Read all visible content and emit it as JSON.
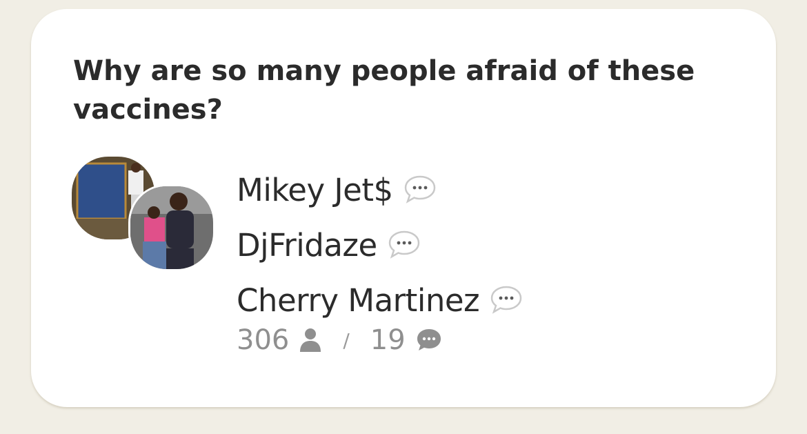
{
  "room": {
    "title": "Why are so many people afraid of these vaccines?",
    "speakers": [
      {
        "name": "Mikey Jet$",
        "icon": "speech-bubble-icon"
      },
      {
        "name": "DjFridaze",
        "icon": "speech-bubble-icon"
      },
      {
        "name": "Cherry Martinez",
        "icon": "speech-bubble-icon"
      }
    ],
    "stats": {
      "listeners": "306",
      "listeners_icon": "person-icon",
      "separator": "/",
      "speakers_count": "19",
      "speakers_icon": "chat-bubble-icon"
    }
  },
  "colors": {
    "background": "#f1eee5",
    "card": "#ffffff",
    "title_text": "#2b2b2b",
    "muted_text": "#8f8f8f"
  }
}
